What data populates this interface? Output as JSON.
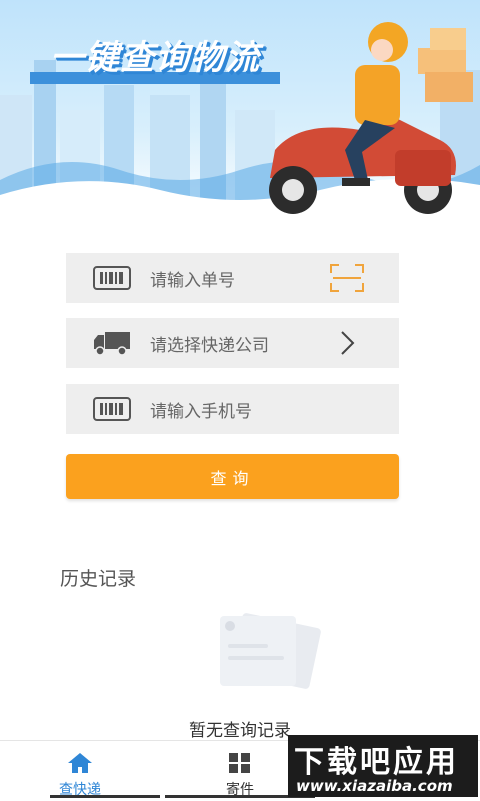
{
  "banner": {
    "title": "一键查询物流"
  },
  "form": {
    "tracking_placeholder": "请输入单号",
    "courier_placeholder": "请选择快递公司",
    "phone_placeholder": "请输入手机号",
    "query_label": "查询"
  },
  "history": {
    "title": "历史记录",
    "empty_text": "暂无查询记录"
  },
  "nav": {
    "items": [
      {
        "label": "查快递",
        "icon": "home-icon",
        "active": true
      },
      {
        "label": "寄件",
        "icon": "grid-icon",
        "active": false
      }
    ]
  },
  "watermark": {
    "brand": "下载吧应用",
    "url": "www.xiazaiba.com"
  },
  "colors": {
    "accent": "#fba11e",
    "primary": "#2f86d6",
    "scan_icon": "#f0a43c"
  }
}
